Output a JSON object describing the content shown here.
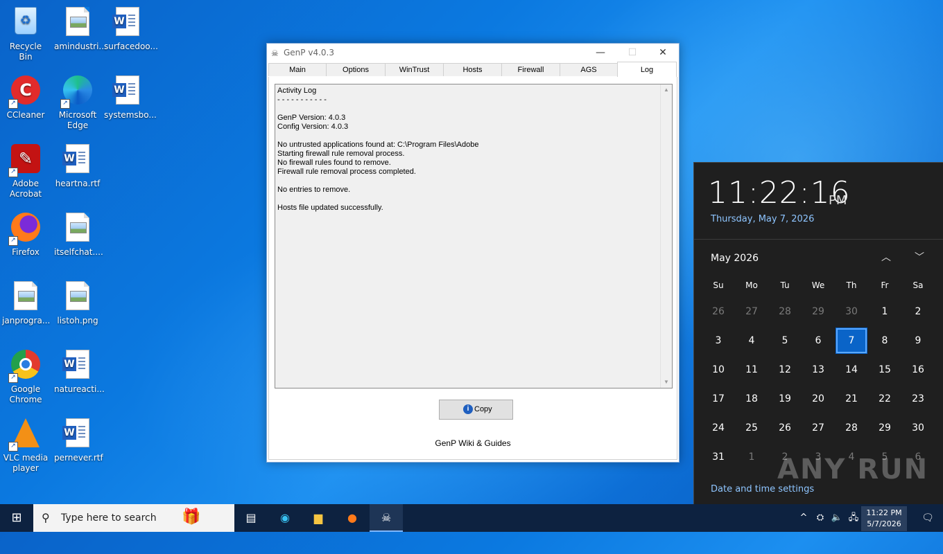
{
  "desktop": {
    "icons": [
      {
        "label": "Recycle Bin",
        "icon": "recycle-bin-icon"
      },
      {
        "label": "amindustri...",
        "icon": "image-file-icon"
      },
      {
        "label": "surfacedoo...",
        "icon": "word-doc-icon"
      },
      {
        "label": "CCleaner",
        "icon": "ccleaner-icon"
      },
      {
        "label": "Microsoft Edge",
        "icon": "edge-icon"
      },
      {
        "label": "systemsbo...",
        "icon": "word-doc-icon"
      },
      {
        "label": "Adobe Acrobat",
        "icon": "acrobat-icon"
      },
      {
        "label": "heartna.rtf",
        "icon": "word-doc-icon"
      },
      {
        "label": "Firefox",
        "icon": "firefox-icon"
      },
      {
        "label": "itselfchat....",
        "icon": "image-file-icon"
      },
      {
        "label": "janprogra...",
        "icon": "image-file-icon"
      },
      {
        "label": "listoh.png",
        "icon": "image-file-icon"
      },
      {
        "label": "Google Chrome",
        "icon": "chrome-icon"
      },
      {
        "label": "natureacti...",
        "icon": "word-doc-icon"
      },
      {
        "label": "VLC media player",
        "icon": "vlc-icon"
      },
      {
        "label": "pernever.rtf",
        "icon": "word-doc-icon"
      }
    ]
  },
  "window": {
    "title": "GenP v4.0.3",
    "tabs": [
      "Main",
      "Options",
      "WinTrust",
      "Hosts",
      "Firewall",
      "AGS",
      "Log"
    ],
    "active_tab": "Log",
    "log_text": "Activity Log\n- - - - - - - - - - -\n\nGenP Version: 4.0.3\nConfig Version: 4.0.3\n\nNo untrusted applications found at: C:\\Program Files\\Adobe\nStarting firewall rule removal process.\nNo firewall rules found to remove.\nFirewall rule removal process completed.\n\nNo entries to remove.\n\nHosts file updated successfully.",
    "copy_label": "Copy",
    "wiki_link": "GenP Wiki & Guides"
  },
  "clock": {
    "time": "11:22:16",
    "ampm": "PM",
    "long_date": "Thursday, May 7, 2026",
    "month_label": "May 2026",
    "weekdays": [
      "Su",
      "Mo",
      "Tu",
      "We",
      "Th",
      "Fr",
      "Sa"
    ],
    "weeks": [
      [
        "26",
        "27",
        "28",
        "29",
        "30",
        "1",
        "2"
      ],
      [
        "3",
        "4",
        "5",
        "6",
        "7",
        "8",
        "9"
      ],
      [
        "10",
        "11",
        "12",
        "13",
        "14",
        "15",
        "16"
      ],
      [
        "17",
        "18",
        "19",
        "20",
        "21",
        "22",
        "23"
      ],
      [
        "24",
        "25",
        "26",
        "27",
        "28",
        "29",
        "30"
      ],
      [
        "31",
        "1",
        "2",
        "3",
        "4",
        "5",
        "6"
      ]
    ],
    "today": "7",
    "settings_link": "Date and time settings",
    "watermark": "ANY RUN"
  },
  "taskbar": {
    "search_placeholder": "Type here to search",
    "time": "11:22 PM",
    "date": "5/7/2026"
  }
}
